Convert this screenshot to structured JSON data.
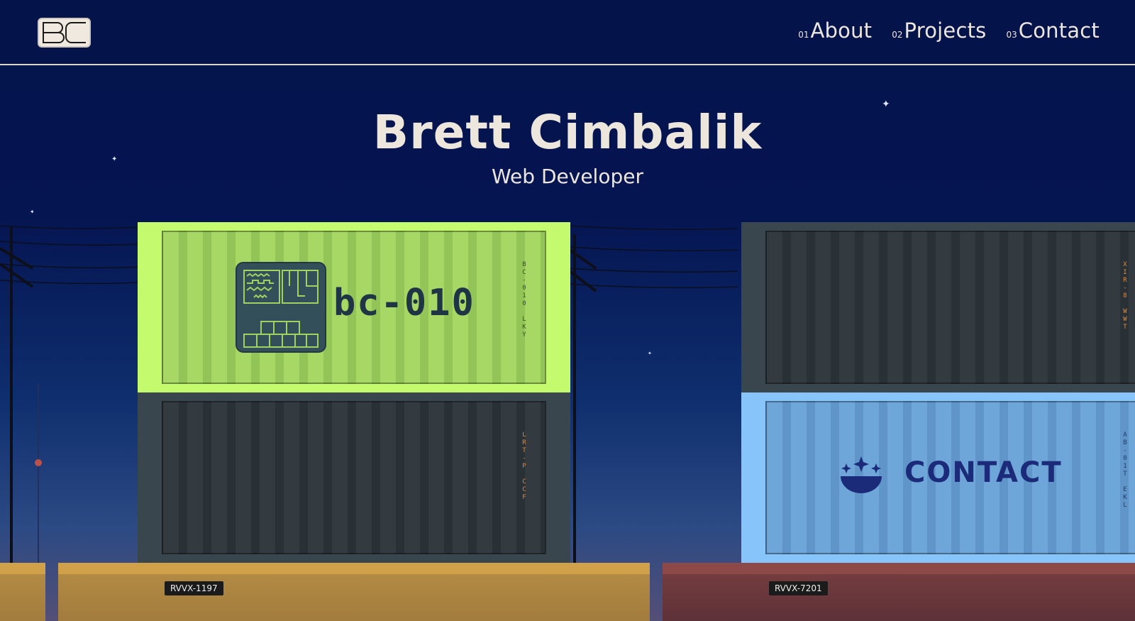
{
  "header": {
    "logo_alt": "BC",
    "nav": [
      {
        "num": "01",
        "label": "About"
      },
      {
        "num": "02",
        "label": "Projects"
      },
      {
        "num": "03",
        "label": "Contact"
      }
    ]
  },
  "hero": {
    "title": "Brett Cimbalik",
    "subtitle": "Web Developer"
  },
  "containers": {
    "projects": {
      "label": "bc-010",
      "code": "BC-010 LKY"
    },
    "dark_bottom_left": {
      "code": "LRT-P CCF"
    },
    "dark_top_right": {
      "code": "XIR-8 WWT"
    },
    "contact": {
      "label": "CONTACT",
      "code": "AB-01T EKL"
    }
  },
  "flatcars": [
    {
      "plate": "RVVX-1197"
    },
    {
      "plate": "RVVX-7201"
    }
  ],
  "colors": {
    "sky_top": "#04134a",
    "text_light": "#ece6dd",
    "container_green": "#c4fb6e",
    "container_blue": "#86c4fa",
    "container_dark": "#3a464e",
    "flatcar_yellow": "#d1a14a",
    "flatcar_red": "#8d4848"
  }
}
